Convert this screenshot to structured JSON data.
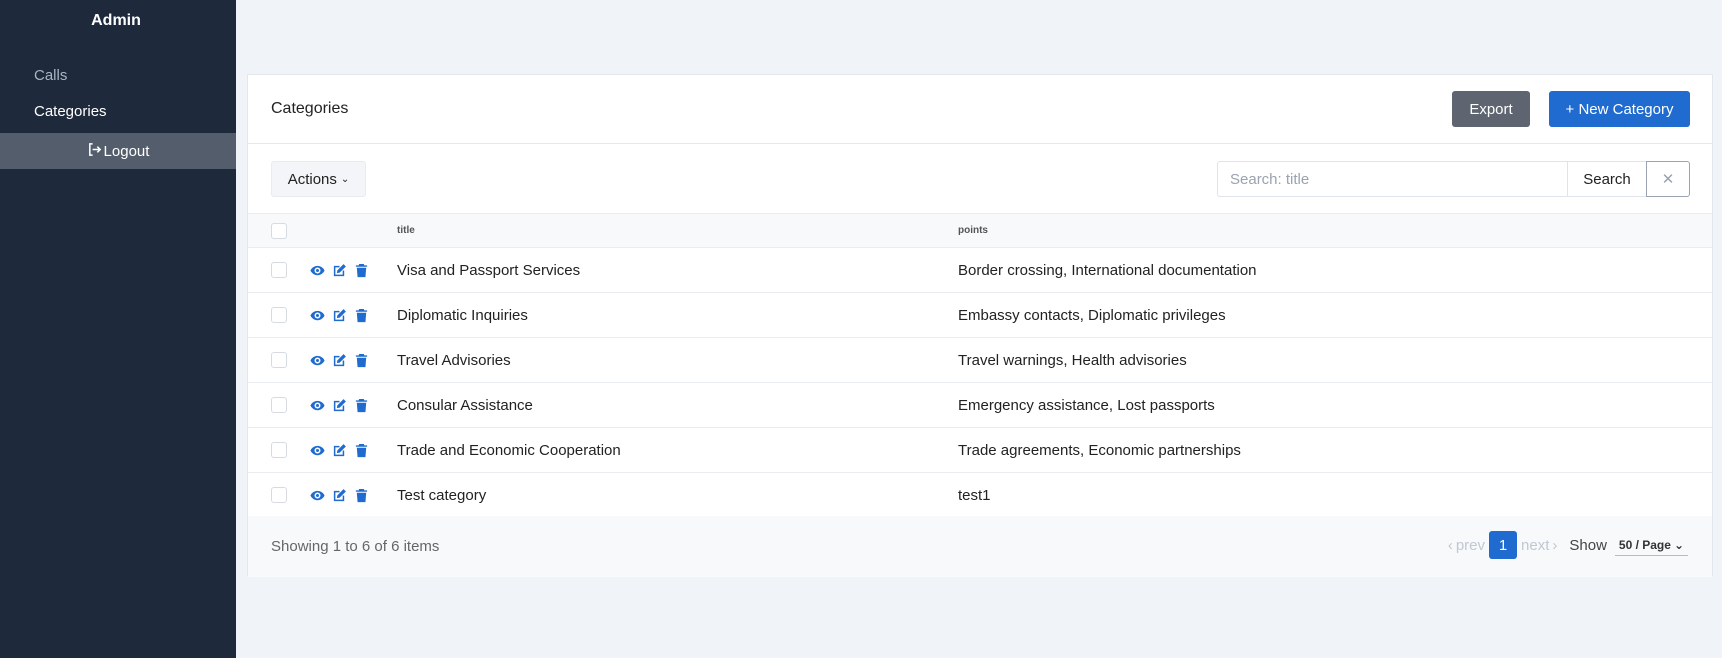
{
  "sidebar": {
    "brand": "Admin",
    "items": [
      {
        "label": "Calls"
      },
      {
        "label": "Categories"
      }
    ],
    "logout_label": "Logout"
  },
  "header": {
    "title": "Categories",
    "export_label": "Export",
    "new_label": "+ New Category"
  },
  "toolbar": {
    "actions_label": "Actions",
    "search_placeholder": "Search: title",
    "search_label": "Search",
    "clear_label": "✕"
  },
  "table": {
    "columns": [
      "title",
      "points"
    ],
    "rows": [
      {
        "title": "Visa and Passport Services",
        "points": "Border crossing, International documentation"
      },
      {
        "title": "Diplomatic Inquiries",
        "points": "Embassy contacts, Diplomatic privileges"
      },
      {
        "title": "Travel Advisories",
        "points": "Travel warnings, Health advisories"
      },
      {
        "title": "Consular Assistance",
        "points": "Emergency assistance, Lost passports"
      },
      {
        "title": "Trade and Economic Cooperation",
        "points": "Trade agreements, Economic partnerships"
      },
      {
        "title": "Test category",
        "points": "test1"
      }
    ],
    "row_icons": [
      "eye-icon",
      "edit-icon",
      "trash-icon"
    ]
  },
  "footer": {
    "summary": "Showing 1 to 6 of 6 items",
    "prev_label": "prev",
    "page": "1",
    "next_label": "next",
    "show_label": "Show",
    "per_page": "50 / Page"
  },
  "colors": {
    "sidebar_bg": "#1e293b",
    "accent": "#1f6bd0",
    "export_bg": "#5e6470"
  }
}
